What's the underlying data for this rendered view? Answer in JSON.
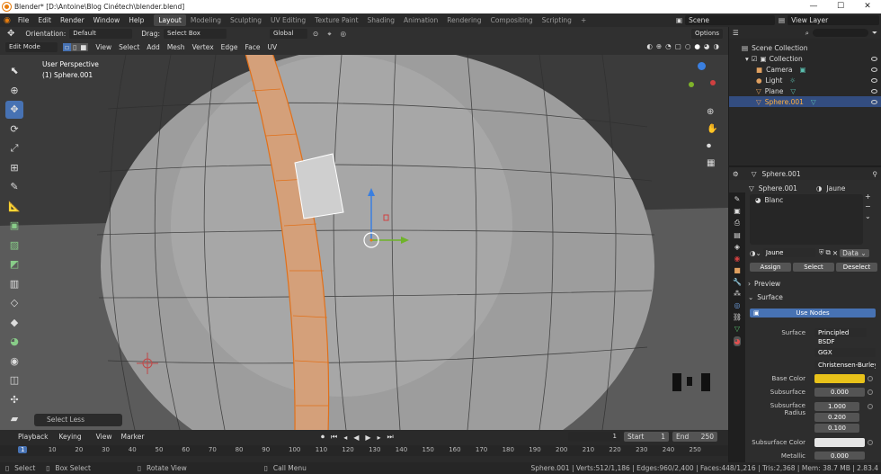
{
  "title_bar": {
    "title": "Blender* [D:\\Antoine\\Blog Cinétech\\blender.blend]"
  },
  "menu": [
    "File",
    "Edit",
    "Render",
    "Window",
    "Help"
  ],
  "workspaces": [
    "Layout",
    "Modeling",
    "Sculpting",
    "UV Editing",
    "Texture Paint",
    "Shading",
    "Animation",
    "Rendering",
    "Compositing",
    "Scripting"
  ],
  "scene_name": "Scene",
  "view_layer": "View Layer",
  "header1": {
    "orientation_label": "Orientation:",
    "orientation_value": "Default",
    "drag_label": "Drag:",
    "drag_value": "Select Box",
    "transform": "Global",
    "options": "Options"
  },
  "header2": {
    "mode": "Edit Mode",
    "menus": [
      "View",
      "Select",
      "Add",
      "Mesh",
      "Vertex",
      "Edge",
      "Face",
      "UV"
    ]
  },
  "viewport": {
    "perspective": "User Perspective",
    "object": "(1) Sphere.001",
    "last_op": "Select Less"
  },
  "outliner": {
    "root": "Scene Collection",
    "collection": "Collection",
    "items": [
      "Camera",
      "Light",
      "Plane",
      "Sphere.001"
    ]
  },
  "properties": {
    "header_object": "Sphere.001",
    "breadcrumb_object": "Sphere.001",
    "breadcrumb_material": "Jaune",
    "slot_partial": "Blanc",
    "material_name": "Jaune",
    "assign": "Assign",
    "select": "Select",
    "deselect": "Deselect",
    "preview": "Preview",
    "surface": "Surface",
    "use_nodes": "Use Nodes",
    "surface_label": "Surface",
    "surface_value": "Principled BSDF",
    "distribution": "GGX",
    "sss_method": "Christensen-Burley",
    "base_color_label": "Base Color",
    "base_color": "#e8c21a",
    "subsurface_label": "Subsurface",
    "subsurface_value": "0.000",
    "subsurface_radius_label": "Subsurface Radius",
    "radius": [
      "1.000",
      "0.200",
      "0.100"
    ],
    "subsurface_color_label": "Subsurface Color",
    "subsurface_color": "#e6e6e6",
    "metallic_label": "Metallic",
    "metallic_value": "0.000"
  },
  "timeline": {
    "menus": [
      "Playback",
      "Keying",
      "View",
      "Marker"
    ],
    "current_frame": "1",
    "start_label": "Start",
    "start": "1",
    "end_label": "End",
    "end": "250",
    "ticks": [
      "1",
      "10",
      "20",
      "30",
      "40",
      "50",
      "60",
      "70",
      "80",
      "90",
      "100",
      "110",
      "120",
      "130",
      "140",
      "150",
      "160",
      "170",
      "180",
      "190",
      "200",
      "210",
      "220",
      "230",
      "240",
      "250"
    ]
  },
  "statusbar": {
    "select": "Select",
    "box_select": "Box Select",
    "rotate_view": "Rotate View",
    "call_menu": "Call Menu",
    "stats": "Sphere.001 | Verts:512/1,186 | Edges:960/2,400 | Faces:448/1,216 | Tris:2,368 | Mem: 38.7 MB | 2.83.4"
  }
}
